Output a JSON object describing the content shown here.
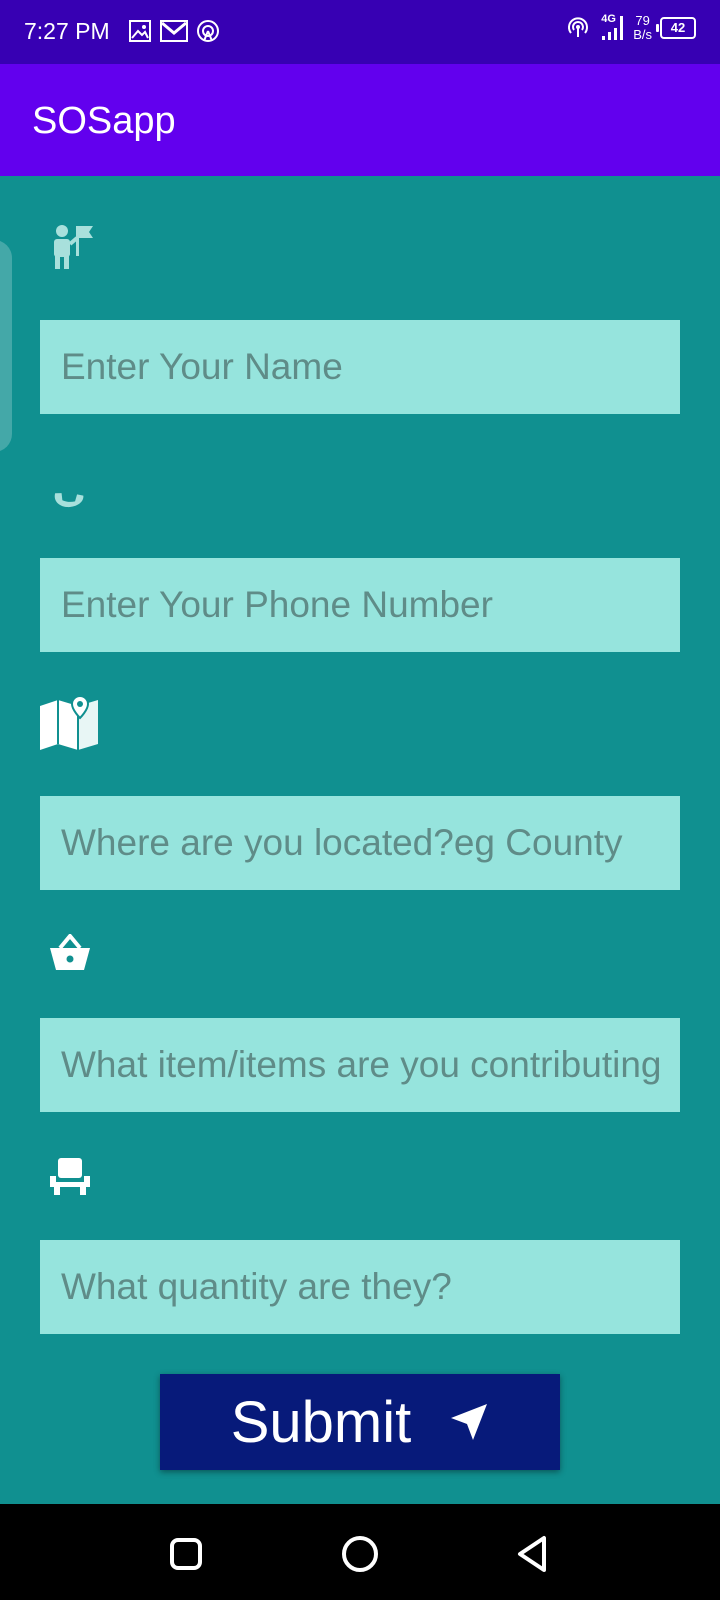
{
  "status_bar": {
    "time": "7:27 PM",
    "left_icons": [
      "image-icon",
      "gmail-icon",
      "hotspot-icon"
    ],
    "network_type": "4G",
    "speed_value": "79",
    "speed_unit": "B/s",
    "battery_level": "42"
  },
  "app_bar": {
    "title": "SOSapp"
  },
  "form": {
    "fields": [
      {
        "icon": "person-flag-icon",
        "placeholder": "Enter Your Name",
        "value": ""
      },
      {
        "icon": "phone-icon",
        "placeholder": "Enter Your Phone Number",
        "value": ""
      },
      {
        "icon": "map-pin-icon",
        "placeholder": "Where are you located?eg County",
        "value": ""
      },
      {
        "icon": "basket-icon",
        "placeholder": "What item/items are you contributing?",
        "value": ""
      },
      {
        "icon": "chair-icon",
        "placeholder": "What quantity are they?",
        "value": ""
      }
    ],
    "submit_label": "Submit",
    "submit_icon": "send-arrow-icon"
  },
  "nav_bar": {
    "buttons": [
      "recents-square-icon",
      "home-circle-icon",
      "back-triangle-icon"
    ]
  },
  "colors": {
    "status_bar": "#3700b3",
    "app_bar": "#6200ee",
    "background": "#109090",
    "field_fill": "#96e4dd",
    "placeholder": "#5f8c88",
    "submit_button": "#071a7a",
    "icon_tint": "#a8e0dc"
  }
}
